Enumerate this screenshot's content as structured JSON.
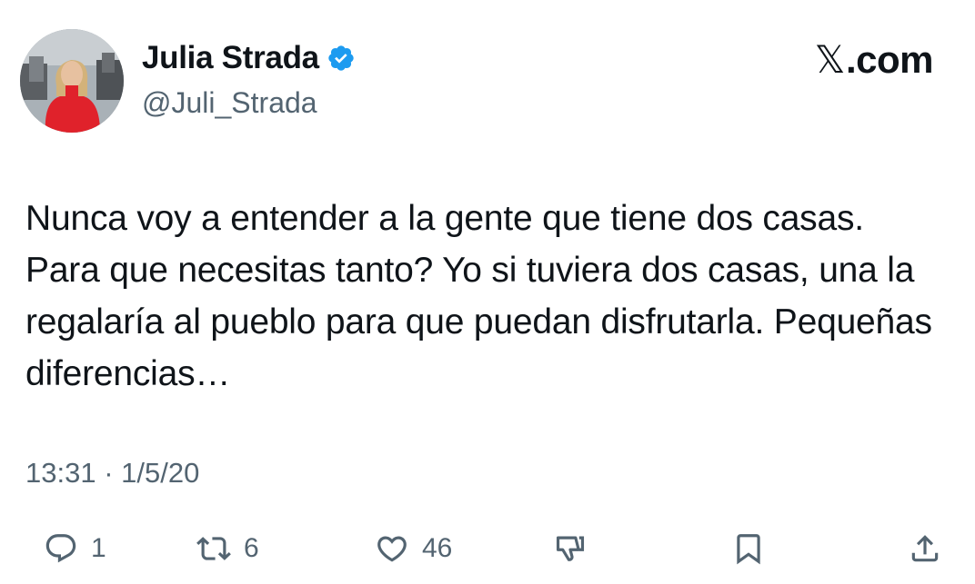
{
  "author": {
    "display_name": "Julia Strada",
    "handle": "@Juli_Strada",
    "verified": true,
    "avatar": "profile-photo"
  },
  "brand": {
    "x_glyph": "𝕏",
    "suffix": ".com"
  },
  "tweet": {
    "text": "Nunca voy a entender a la gente que tiene dos casas. Para que necesitas tanto? Yo si tuviera dos casas, una la regalaría al pueblo para que puedan disfrutarla. Pequeñas diferencias…",
    "timestamp": "13:31 · 1/5/20"
  },
  "actions": {
    "reply": {
      "icon": "reply-icon",
      "count": "1"
    },
    "repost": {
      "icon": "repost-icon",
      "count": "6"
    },
    "like": {
      "icon": "heart-icon",
      "count": "46"
    },
    "dislike": {
      "icon": "thumbs-down-icon"
    },
    "bookmark": {
      "icon": "bookmark-icon"
    },
    "share": {
      "icon": "share-icon"
    }
  },
  "colors": {
    "text": "#0f1419",
    "secondary": "#536471",
    "verified_badge": "#1d9bf0",
    "avatar_dress": "#e0222b"
  }
}
